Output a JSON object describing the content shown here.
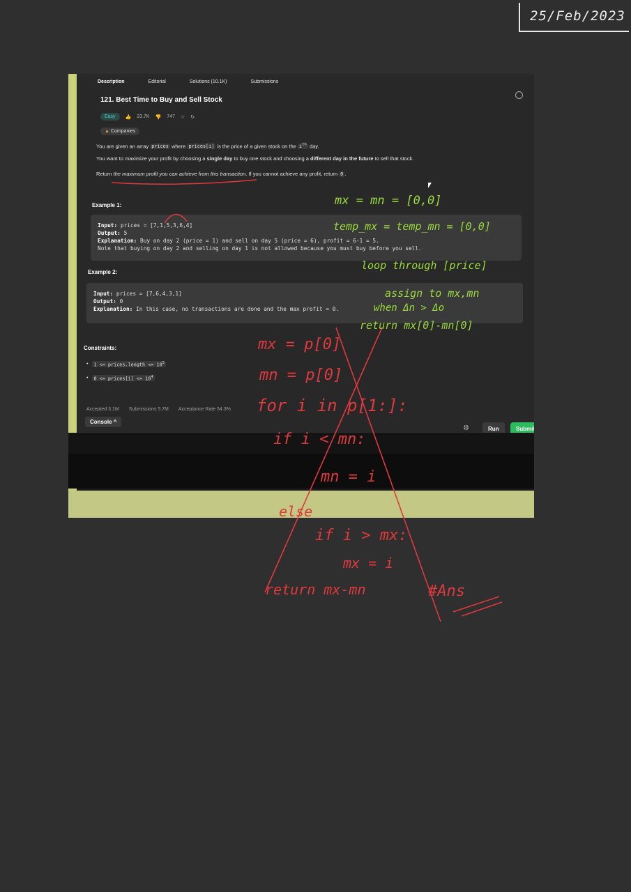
{
  "date_note": "25/Feb/2023",
  "tabs": [
    "Description",
    "Editorial",
    "Solutions (10.1K)",
    "Submissions"
  ],
  "problem": {
    "title": "121. Best Time to Buy and Sell Stock",
    "difficulty": "Easy",
    "likes": "23.7K",
    "dislikes": "747",
    "companies_label": "Companies",
    "desc1_pre": "You are given an array",
    "desc1_code1": "prices",
    "desc1_mid": "where",
    "desc1_code2": "prices[i]",
    "desc1_post": "is the price of a given stock on the",
    "desc1_code3": "i",
    "desc1_sup": "th",
    "desc1_end": "day.",
    "desc2_pre": "You want to maximize your profit by choosing a",
    "desc2_b1": "single day",
    "desc2_mid": "to buy one stock and choosing a",
    "desc2_b2": "different day in the future",
    "desc2_end": "to sell that stock.",
    "desc3_pre": "Return",
    "desc3_em": "the maximum profit you can achieve from this transaction",
    "desc3_mid": ". If you cannot achieve any profit, return",
    "desc3_code": "0",
    "desc3_end": "."
  },
  "example1": {
    "title": "Example 1:",
    "input_label": "Input:",
    "input": "prices = [7,1,5,3,6,4]",
    "output_label": "Output:",
    "output": "5",
    "explanation_label": "Explanation:",
    "explanation": "Buy on day 2 (price = 1) and sell on day 5 (price = 6), profit = 6-1 = 5.",
    "note": "Note that buying on day 2 and selling on day 1 is not allowed because you must buy before you sell."
  },
  "example2": {
    "title": "Example 2:",
    "input_label": "Input:",
    "input": "prices = [7,6,4,3,1]",
    "output_label": "Output:",
    "output": "0",
    "explanation_label": "Explanation:",
    "explanation": "In this case, no transactions are done and the max profit = 0."
  },
  "constraints": {
    "title": "Constraints:",
    "c1_pre": "1 <= prices.length <= 10",
    "c1_sup": "5",
    "c2_pre": "0 <= prices[i] <= 10",
    "c2_sup": "4"
  },
  "stats": {
    "accepted": "Accepted 3.1M",
    "submissions": "Submissions 5.7M",
    "acceptance": "Acceptance Rate 54.3%"
  },
  "footer": {
    "console": "Console ^",
    "run": "Run",
    "submit": "Submit"
  },
  "notes_green": [
    "mx = mn = [0,0]",
    "temp_mx = temp_mn = [0,0]",
    "loop through [price]",
    "assign to mx,mn",
    "when Δn > Δo",
    "return  mx[0]-mn[0]"
  ],
  "notes_red": [
    "mx = p[0]",
    "mn = p[0]",
    "for i in p[1:]:",
    "if i < mn:",
    "mn = i",
    "else",
    "if i > mx:",
    "mx = i",
    "return  mx-mn",
    "#Ans"
  ],
  "colors": {
    "green_ink": "#9adb3a",
    "red_ink": "#e0393d",
    "submit": "#2cbb5d",
    "easy": "#4fd1c5"
  },
  "icons": [
    "thumbs-up-icon",
    "thumbs-down-icon",
    "star-icon",
    "share-icon",
    "info-icon",
    "bug-icon",
    "cursor-icon"
  ]
}
